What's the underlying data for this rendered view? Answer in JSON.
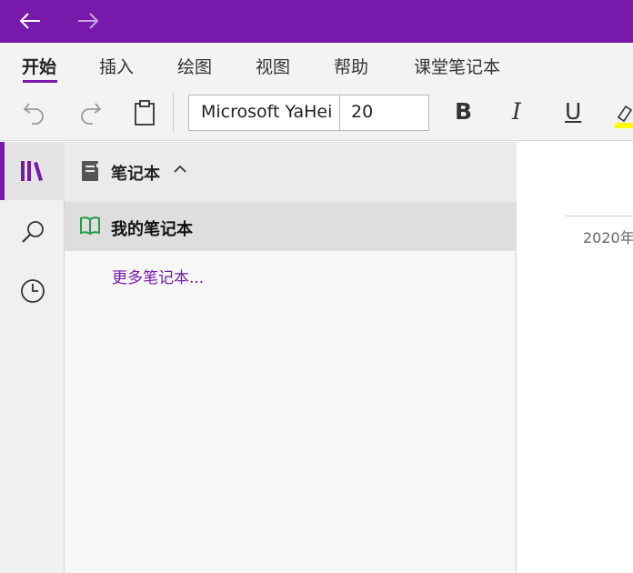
{
  "titlebar": {
    "bg_color": "#7719aa",
    "back_icon": "arrow-left-icon",
    "forward_icon": "arrow-right-icon"
  },
  "ribbon": {
    "tabs": [
      {
        "label": "开始",
        "active": true
      },
      {
        "label": "插入",
        "active": false
      },
      {
        "label": "绘图",
        "active": false
      },
      {
        "label": "视图",
        "active": false
      },
      {
        "label": "帮助",
        "active": false
      },
      {
        "label": "课堂笔记本",
        "active": false
      }
    ],
    "accent": "#7719aa"
  },
  "toolbar": {
    "undo_icon": "undo-icon",
    "redo_icon": "redo-icon",
    "paste_icon": "clipboard-icon",
    "font_name": "Microsoft YaHei",
    "font_size": "20",
    "bold_label": "B",
    "italic_label": "I",
    "underline_label": "U",
    "highlight_icon": "highlighter-icon",
    "highlight_color": "#ffff00"
  },
  "rail": {
    "items": [
      {
        "icon": "notebooks-icon",
        "active": true
      },
      {
        "icon": "search-icon",
        "active": false
      },
      {
        "icon": "recent-clock-icon",
        "active": false
      }
    ]
  },
  "panel": {
    "header_title": "笔记本",
    "header_icon": "notebook-icon",
    "notebooks": [
      {
        "label": "我的笔记本",
        "icon": "open-book-icon",
        "color": "#1e9e4a"
      }
    ],
    "more_link": "更多笔记本..."
  },
  "page": {
    "date": "2020年"
  }
}
